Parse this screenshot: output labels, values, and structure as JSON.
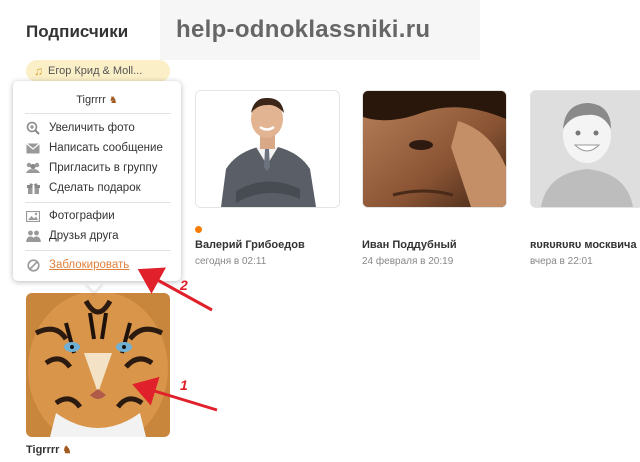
{
  "page": {
    "title": "Подписчики",
    "watermark": "help-odnoklassniki.ru",
    "music": {
      "icon": "music-note-icon",
      "label": "Егор Крид & Moll..."
    }
  },
  "menu": {
    "user_name": "Tigrrrr",
    "items": [
      {
        "icon": "zoom-icon",
        "label": "Увеличить фото"
      },
      {
        "icon": "envelope-icon",
        "label": "Написать сообщение"
      },
      {
        "icon": "group-icon",
        "label": "Пригласить в группу"
      },
      {
        "icon": "gift-icon",
        "label": "Сделать подарок"
      },
      {
        "icon": "photo-icon",
        "label": "Фотографии"
      },
      {
        "icon": "friends-icon",
        "label": "Друзья друга"
      },
      {
        "icon": "block-icon",
        "label": "Заблокировать"
      }
    ]
  },
  "subscribers": [
    {
      "name": "Валерий Грибоедов",
      "time": "сегодня в 02:11",
      "online": true
    },
    {
      "name": "Иван Поддубный",
      "time": "24 февраля в 20:19"
    },
    {
      "name": "ʀᴜʀᴜʀᴜʀᴜ москвича",
      "time": "вчера в 22:01"
    },
    {
      "name": "Tigrrrr"
    }
  ],
  "annotations": [
    {
      "number": "1"
    },
    {
      "number": "2"
    }
  ],
  "colors": {
    "accent": "#e0803a",
    "annotation": "#e0202a",
    "online": "#f57c00",
    "chip": "#fbefc7"
  }
}
